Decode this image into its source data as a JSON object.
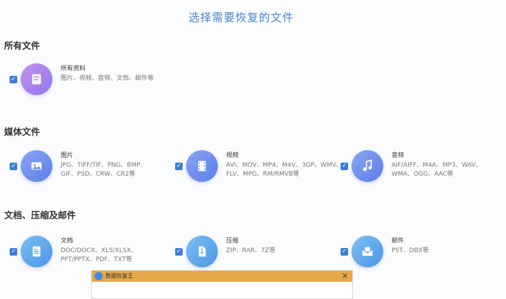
{
  "page": {
    "title": "选择需要恢复的文件"
  },
  "sections": [
    {
      "title": "所有文件"
    },
    {
      "title": "媒体文件"
    },
    {
      "title": "文档、压缩及邮件"
    }
  ],
  "checkbox_mark": "✓",
  "cards": [
    {
      "name": "所有资料",
      "desc": "图片、视频、音频、文档、邮件等",
      "checked": true,
      "icon": "file-icon",
      "color": "#b07be8"
    },
    {
      "name": "图片",
      "desc": "JPG、TIFF/TIF、PNG、BMP、GIF、PSD、CRW、CR2等",
      "checked": true,
      "icon": "image-icon",
      "color": "#6f8ff0"
    },
    {
      "name": "视频",
      "desc": "AVI、MOV、MP4、M4V、3GP、WMV、FLV、MPG、RM/RMVB等",
      "checked": true,
      "icon": "video-icon",
      "color": "#6f8ff0"
    },
    {
      "name": "音频",
      "desc": "AIF/AIFF、M4A、MP3、WAV、WMA、OGG、AAC等",
      "checked": true,
      "icon": "music-icon",
      "color": "#6f8ff0"
    },
    {
      "name": "文档",
      "desc": "DOC/DOCX、XLS/XLSX、PPT/PPTX、PDF、TXT等",
      "checked": true,
      "icon": "document-icon",
      "color": "#5aa8ee"
    },
    {
      "name": "压缩",
      "desc": "ZIP、RAR、7Z等",
      "checked": true,
      "icon": "archive-icon",
      "color": "#5aa8ee"
    },
    {
      "name": "邮件",
      "desc": "PST、DBX等",
      "checked": true,
      "icon": "mail-icon",
      "color": "#5aa8ee"
    }
  ],
  "dialog": {
    "title": "数据恢复王",
    "close": "✕"
  }
}
